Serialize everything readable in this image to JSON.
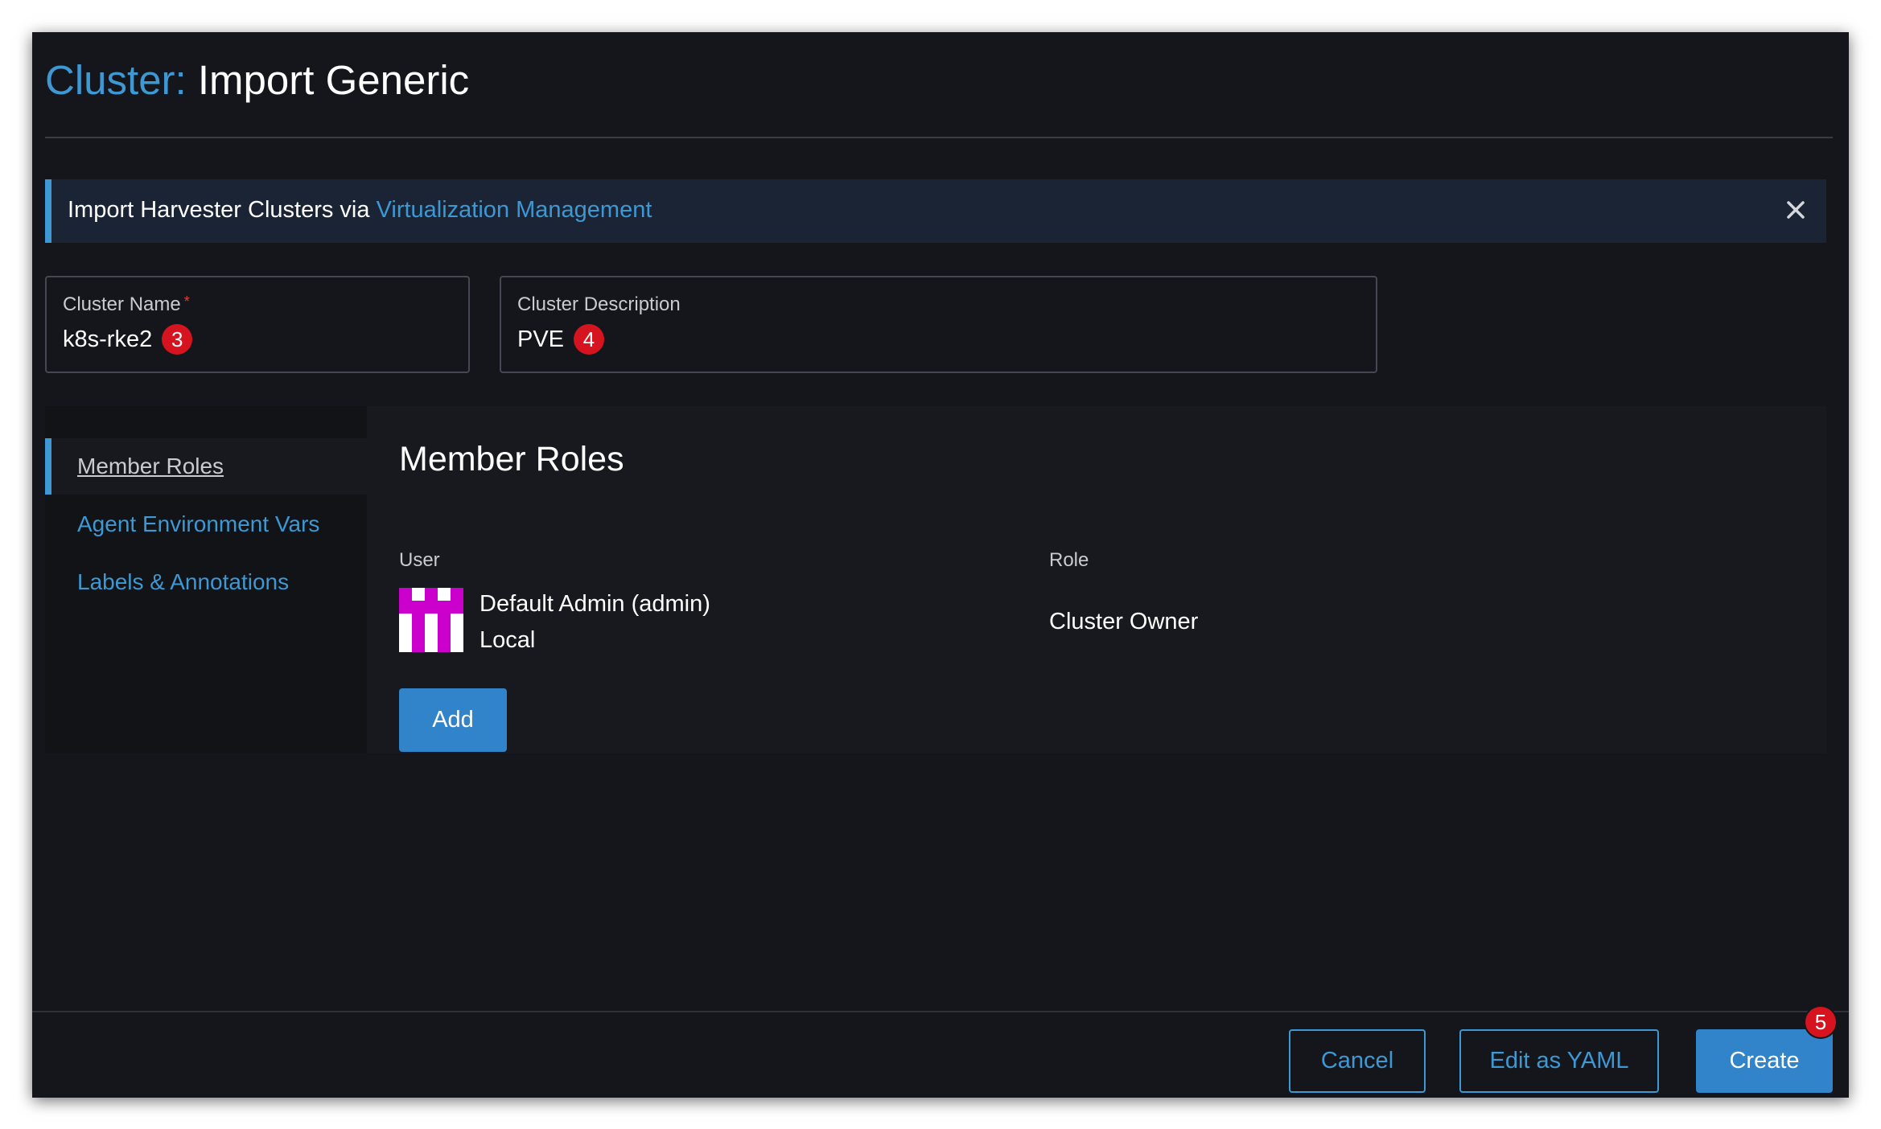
{
  "header": {
    "title_prefix": "Cluster:",
    "title": "Import Generic"
  },
  "banner": {
    "text": "Import Harvester Clusters via",
    "link": "Virtualization Management",
    "close_icon": "close-icon"
  },
  "form": {
    "cluster_name": {
      "label": "Cluster Name",
      "required_mark": "*",
      "value": "k8s-rke2",
      "badge": "3"
    },
    "cluster_description": {
      "label": "Cluster Description",
      "value": "PVE",
      "badge": "4"
    }
  },
  "tabs": [
    {
      "label": "Member Roles",
      "active": true
    },
    {
      "label": "Agent Environment Vars",
      "active": false
    },
    {
      "label": "Labels & Annotations",
      "active": false
    }
  ],
  "member_roles": {
    "title": "Member Roles",
    "columns": {
      "user": "User",
      "role": "Role"
    },
    "rows": [
      {
        "avatar_icon": "identicon-avatar",
        "name": "Default Admin (admin)",
        "provider": "Local",
        "role": "Cluster Owner"
      }
    ],
    "add_button": "Add"
  },
  "footer": {
    "cancel": "Cancel",
    "edit_yaml": "Edit as YAML",
    "create": "Create",
    "create_badge": "5"
  },
  "colors": {
    "accent": "#3d98d3",
    "button": "#3184c9",
    "badge": "#d5141f",
    "background": "#15161b",
    "avatar": "#cc00cc"
  }
}
